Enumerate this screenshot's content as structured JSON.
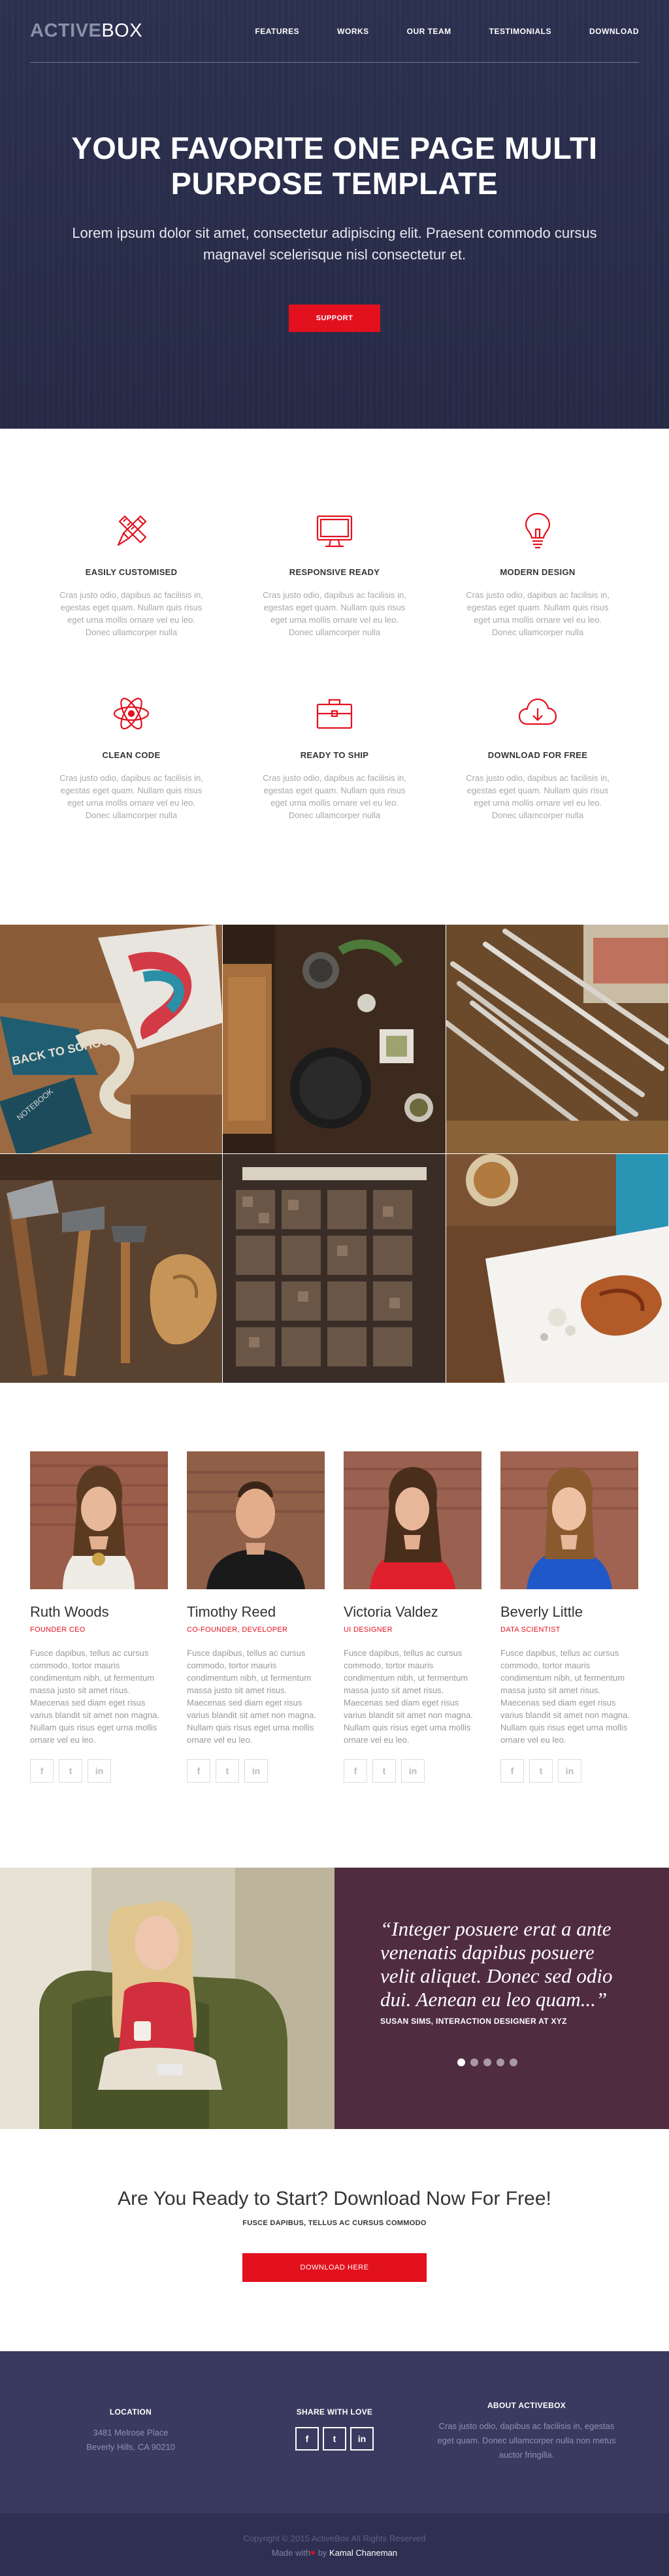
{
  "brand": {
    "part1": "ACTIVE",
    "part2": "BOX"
  },
  "nav": [
    {
      "label": "FEATURES"
    },
    {
      "label": "WORKS"
    },
    {
      "label": "OUR TEAM"
    },
    {
      "label": "TESTIMONIALS"
    },
    {
      "label": "DOWNLOAD"
    }
  ],
  "hero": {
    "title": "YOUR FAVORITE ONE PAGE MULTI PURPOSE TEMPLATE",
    "subtitle": "Lorem ipsum dolor sit amet, consectetur adipiscing elit. Praesent commodo cursus magnavel scelerisque nisl consectetur et.",
    "button": "SUPPORT"
  },
  "features": [
    {
      "title": "EASILY CUSTOMISED",
      "icon": "pencil-ruler-icon",
      "text": "Cras justo odio, dapibus ac facilisis in, egestas eget quam. Nullam quis risus eget urna mollis ornare vel eu leo. Donec ullamcorper nulla"
    },
    {
      "title": "RESPONSIVE READY",
      "icon": "monitor-icon",
      "text": "Cras justo odio, dapibus ac facilisis in, egestas eget quam. Nullam quis risus eget urna mollis ornare vel eu leo. Donec ullamcorper nulla"
    },
    {
      "title": "MODERN DESIGN",
      "icon": "lightbulb-icon",
      "text": "Cras justo odio, dapibus ac facilisis in, egestas eget quam. Nullam quis risus eget urna mollis ornare vel eu leo. Donec ullamcorper nulla"
    },
    {
      "title": "CLEAN CODE",
      "icon": "atom-icon",
      "text": "Cras justo odio, dapibus ac facilisis in, egestas eget quam. Nullam quis risus eget urna mollis ornare vel eu leo. Donec ullamcorper nulla"
    },
    {
      "title": "READY TO SHIP",
      "icon": "briefcase-icon",
      "text": "Cras justo odio, dapibus ac facilisis in, egestas eget quam. Nullam quis risus eget urna mollis ornare vel eu leo. Donec ullamcorper nulla"
    },
    {
      "title": "DOWNLOAD FOR FREE",
      "icon": "cloud-download-icon",
      "text": "Cras justo odio, dapibus ac facilisis in, egestas eget quam. Nullam quis risus eget urna mollis ornare vel eu leo. Donec ullamcorper nulla"
    }
  ],
  "gallery_labels": {
    "back_to_school": "BACK TO SCHOOL",
    "notebook": "NOTEBOOK"
  },
  "team": [
    {
      "name": "Ruth Woods",
      "role": "FOUNDER CEO",
      "text": "Fusce dapibus, tellus ac cursus commodo, tortor mauris condimentum nibh, ut fermentum massa justo sit amet risus. Maecenas sed diam eget risus varius blandit sit amet non magna. Nullam quis risus eget urna mollis ornare vel eu leo."
    },
    {
      "name": "Timothy Reed",
      "role": "CO-FOUNDER, DEVELOPER",
      "text": "Fusce dapibus, tellus ac cursus commodo, tortor mauris condimentum nibh, ut fermentum massa justo sit amet risus. Maecenas sed diam eget risus varius blandit sit amet non magna. Nullam quis risus eget urna mollis ornare vel eu leo."
    },
    {
      "name": "Victoria Valdez",
      "role": "UI DESIGNER",
      "text": "Fusce dapibus, tellus ac cursus commodo, tortor mauris condimentum nibh, ut fermentum massa justo sit amet risus. Maecenas sed diam eget risus varius blandit sit amet non magna. Nullam quis risus eget urna mollis ornare vel eu leo."
    },
    {
      "name": "Beverly Little",
      "role": "DATA SCIENTIST",
      "text": "Fusce dapibus, tellus ac cursus commodo, tortor mauris condimentum nibh, ut fermentum massa justo sit amet risus. Maecenas sed diam eget risus varius blandit sit amet non magna. Nullam quis risus eget urna mollis ornare vel eu leo."
    }
  ],
  "social_icons": {
    "facebook": "f",
    "twitter": "t",
    "linkedin": "in"
  },
  "testimonial": {
    "quote": "“Integer posuere erat a ante venenatis dapibus posuere velit aliquet. Donec sed odio dui. Aenean eu leo quam...”",
    "author": "SUSAN SIMS, INTERACTION DESIGNER AT XYZ",
    "active_slide": 1,
    "slide_count": 5
  },
  "cta": {
    "title": "Are You Ready to Start? Download Now For Free!",
    "subtitle": "FUSCE DAPIBUS, TELLUS AC CURSUS COMMODO",
    "button": "DOWNLOAD HERE"
  },
  "footer": {
    "location_title": "LOCATION",
    "address_line1": "3481 Melrose Place",
    "address_line2": "Beverly Hills, CA 90210",
    "share_title": "SHARE WITH LOVE",
    "about_title": "ABOUT ACTIVEBOX",
    "about_text": "Cras justo odio, dapibus ac facilisis in, egestas eget quam. Donec ullamcorper nulla non metus auctor fringilla."
  },
  "copyright": {
    "line1": "Copyright © 2015 ActiveBox All Rights Reserved",
    "made_with": "Made with",
    "heart": "♥",
    "by": " by ",
    "author": "Kamal Chaneman"
  },
  "colors": {
    "accent": "#e3101e",
    "hero_bg": "#2a2f4d",
    "quote_bg": "#4f2c40",
    "footer_bg": "#3a3a60"
  }
}
